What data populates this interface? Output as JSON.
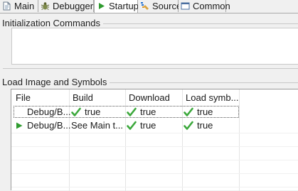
{
  "tabs": [
    {
      "label": "Main",
      "icon": "document-icon"
    },
    {
      "label": "Debugger",
      "icon": "bug-icon"
    },
    {
      "label": "Startup",
      "icon": "play-icon"
    },
    {
      "label": "Source",
      "icon": "source-icon"
    },
    {
      "label": "Common",
      "icon": "window-icon"
    }
  ],
  "active_tab": "Startup",
  "init_section": {
    "title": "Initialization Commands",
    "value": ""
  },
  "load_section": {
    "title": "Load Image and Symbols",
    "columns": [
      "File",
      "Build",
      "Download",
      "Load symb..."
    ],
    "rows": [
      {
        "file": "Debug/B...",
        "build": "true",
        "download": "true",
        "load_symbols": "true",
        "selected": true
      },
      {
        "file": "Debug/B...",
        "build": "See Main t...",
        "download": "true",
        "load_symbols": "true",
        "selected": false,
        "active_marker": true
      }
    ]
  },
  "colors": {
    "check_green": "#3ca83c",
    "play_green": "#2f9b2f",
    "accent_blue": "#1f6fd1"
  }
}
